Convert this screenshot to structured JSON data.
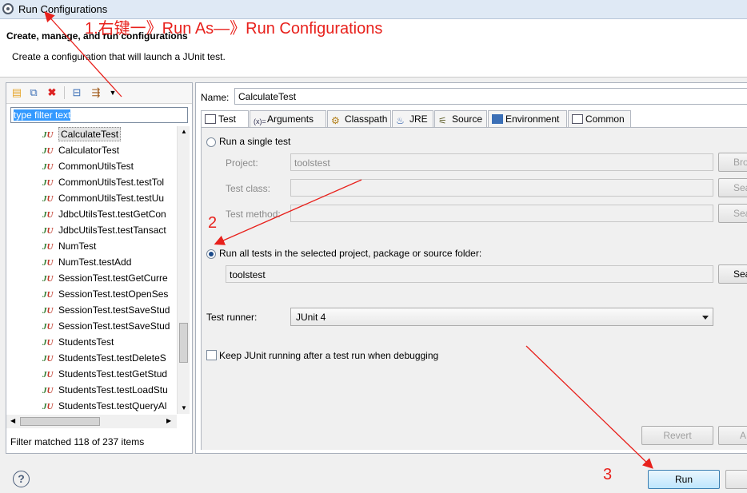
{
  "window": {
    "title": "Run Configurations"
  },
  "header": {
    "title": "Create, manage, and run configurations",
    "message": "Create a configuration that will launch a JUnit test."
  },
  "annotations": {
    "step1": "1.右键一》Run As—》Run Configurations",
    "step2": "2",
    "step3": "3",
    "color": "#e8211c"
  },
  "left": {
    "toolbar_icons": [
      "new-config-icon",
      "duplicate-icon",
      "delete-icon",
      "collapse-all-icon",
      "filter-icon",
      "dropdown-icon"
    ],
    "filter_text": "type filter text",
    "items": [
      "CalculateTest",
      "CalculatorTest",
      "CommonUtilsTest",
      "CommonUtilsTest.testTol",
      "CommonUtilsTest.testUu",
      "JdbcUtilsTest.testGetCon",
      "JdbcUtilsTest.testTansact",
      "NumTest",
      "NumTest.testAdd",
      "SessionTest.testGetCurre",
      "SessionTest.testOpenSes",
      "SessionTest.testSaveStud",
      "SessionTest.testSaveStud",
      "StudentsTest",
      "StudentsTest.testDeleteS",
      "StudentsTest.testGetStud",
      "StudentsTest.testLoadStu",
      "StudentsTest.testQueryAl"
    ],
    "selected_index": 0,
    "status": "Filter matched 118 of 237 items"
  },
  "right": {
    "name_label": "Name:",
    "name_value": "CalculateTest",
    "tabs": [
      {
        "label": "Test",
        "icon": "test-icon"
      },
      {
        "label": "Arguments",
        "icon": "arguments-icon"
      },
      {
        "label": "Classpath",
        "icon": "classpath-icon"
      },
      {
        "label": "JRE",
        "icon": "jre-icon"
      },
      {
        "label": "Source",
        "icon": "source-icon"
      },
      {
        "label": "Environment",
        "icon": "environment-icon"
      },
      {
        "label": "Common",
        "icon": "common-icon"
      }
    ],
    "single_test_label": "Run a single test",
    "project_label": "Project:",
    "project_value": "toolstest",
    "browse_label": "Bro",
    "test_class_label": "Test class:",
    "search_label": "Sea",
    "test_method_label": "Test method:",
    "run_all_label": "Run all tests in the selected project, package or source folder:",
    "run_all_value": "toolstest",
    "runner_label": "Test runner:",
    "runner_value": "JUnit 4",
    "keep_running_label": "Keep JUnit running after a test run when debugging",
    "revert_label": "Revert",
    "apply_label": "A"
  },
  "footer": {
    "help": "?",
    "run_label": "Run"
  }
}
